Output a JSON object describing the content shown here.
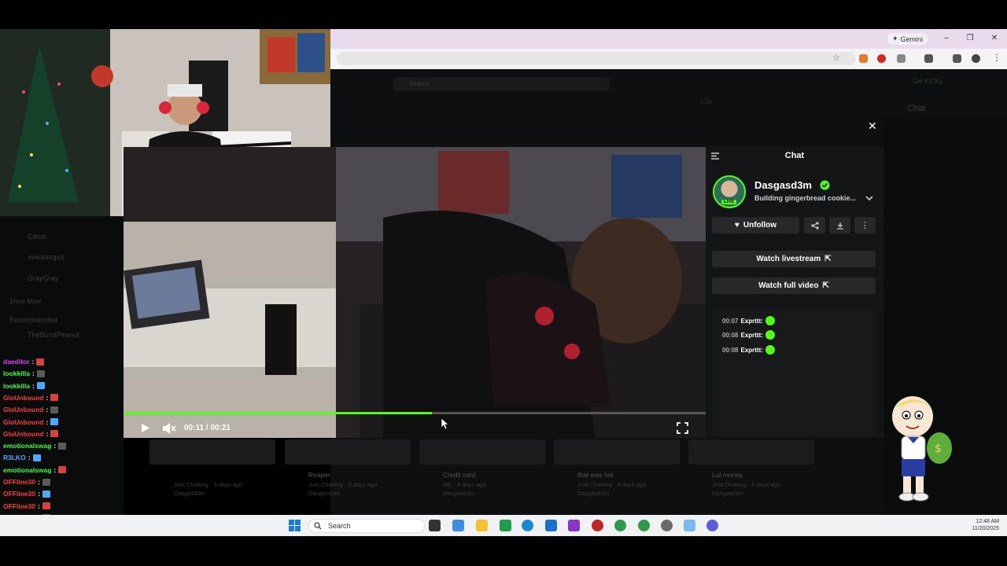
{
  "browser": {
    "gemini_label": "Gemini",
    "site_search_placeholder": "Search",
    "get_kicks_label": "Get KICKs",
    "viewers_text": "1,5k",
    "chat_header": "Chat"
  },
  "left_sidebar": {
    "channels": [
      "Citrus",
      "sweatergxd",
      "GrayGray"
    ],
    "show_more": "Show More",
    "recommended_label": "Recommended",
    "recommended_channel": "TheBurntPeanut"
  },
  "stream_chat": [
    {
      "user": "daeditor",
      "color": "#e03cff"
    },
    {
      "user": "lookkilla",
      "color": "#3cff3c"
    },
    {
      "user": "lookkilla",
      "color": "#3cff3c"
    },
    {
      "user": "GloUnbound",
      "color": "#ff3c3c"
    },
    {
      "user": "GloUnbound",
      "color": "#ff3c3c"
    },
    {
      "user": "GloUnbound",
      "color": "#ff3c3c"
    },
    {
      "user": "GloUnbound",
      "color": "#ff3c3c"
    },
    {
      "user": "emotionalswag",
      "color": "#3cff3c"
    },
    {
      "user": "R3LKO",
      "color": "#4aa8ff"
    },
    {
      "user": "emotionalswag",
      "color": "#3cff3c"
    },
    {
      "user": "OFFline30",
      "color": "#ff3c3c"
    },
    {
      "user": "OFFline30",
      "color": "#ff3c3c"
    },
    {
      "user": "OFFline30",
      "color": "#ff3c3c"
    },
    {
      "user": "OFFline30",
      "color": "#ff3c3c"
    }
  ],
  "player": {
    "time": "00:11 / 00:21",
    "progress": 0.53
  },
  "chat_popup": {
    "title": "Chat",
    "streamer": "Dasgasd3m",
    "live_badge": "LIVE",
    "stream_title": "Building gingerbread cookie...",
    "unfollow_label": "Unfollow",
    "watch_livestream_label": "Watch livestream",
    "watch_full_video_label": "Watch full video",
    "messages": [
      {
        "time": "00:07",
        "user": "Exprttt:"
      },
      {
        "time": "00:08",
        "user": "Exprttt:"
      },
      {
        "time": "00:08",
        "user": "Exprttt:"
      }
    ]
  },
  "videos": [
    {
      "title": "",
      "meta": "Just Chatting · 3 days ago",
      "channel": "Dasgasd3m"
    },
    {
      "title": "Reaper",
      "meta": "Just Chatting · 3 days ago",
      "channel": "Dasgasd3m"
    },
    {
      "title": "Credit card",
      "meta": "IRL · 4 days ago",
      "channel": "Dasgasd3m"
    },
    {
      "title": "that was hot",
      "meta": "Just Chatting · 4 days ago",
      "channel": "Dasgasd3m"
    },
    {
      "title": "Lul money",
      "meta": "Just Chatting · 5 days ago",
      "channel": "Dasgasd3m"
    }
  ],
  "taskbar": {
    "search_placeholder": "Search",
    "time": "12:48 AM",
    "date": "11/20/2025"
  },
  "colors": {
    "accent": "#53fc18",
    "panel": "#141516",
    "button": "#26282a"
  }
}
